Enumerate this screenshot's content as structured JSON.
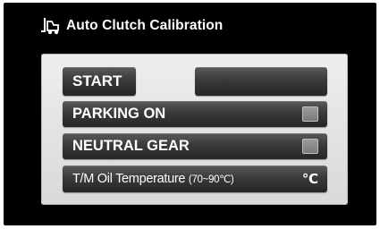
{
  "header": {
    "title": "Auto Clutch Calibration",
    "icon": "forklift-icon"
  },
  "panel": {
    "start_label": "START",
    "status_value": "",
    "parking": {
      "label": "PARKING ON",
      "checked": false
    },
    "neutral": {
      "label": "NEUTRAL GEAR",
      "checked": false
    },
    "temperature": {
      "label": "T/M Oil Temperature",
      "range": "(70~90℃)",
      "unit": "℃"
    }
  },
  "colors": {
    "background": "#000000",
    "panel": "#e6e6e6",
    "button": "#333333",
    "text": "#ffffff"
  }
}
